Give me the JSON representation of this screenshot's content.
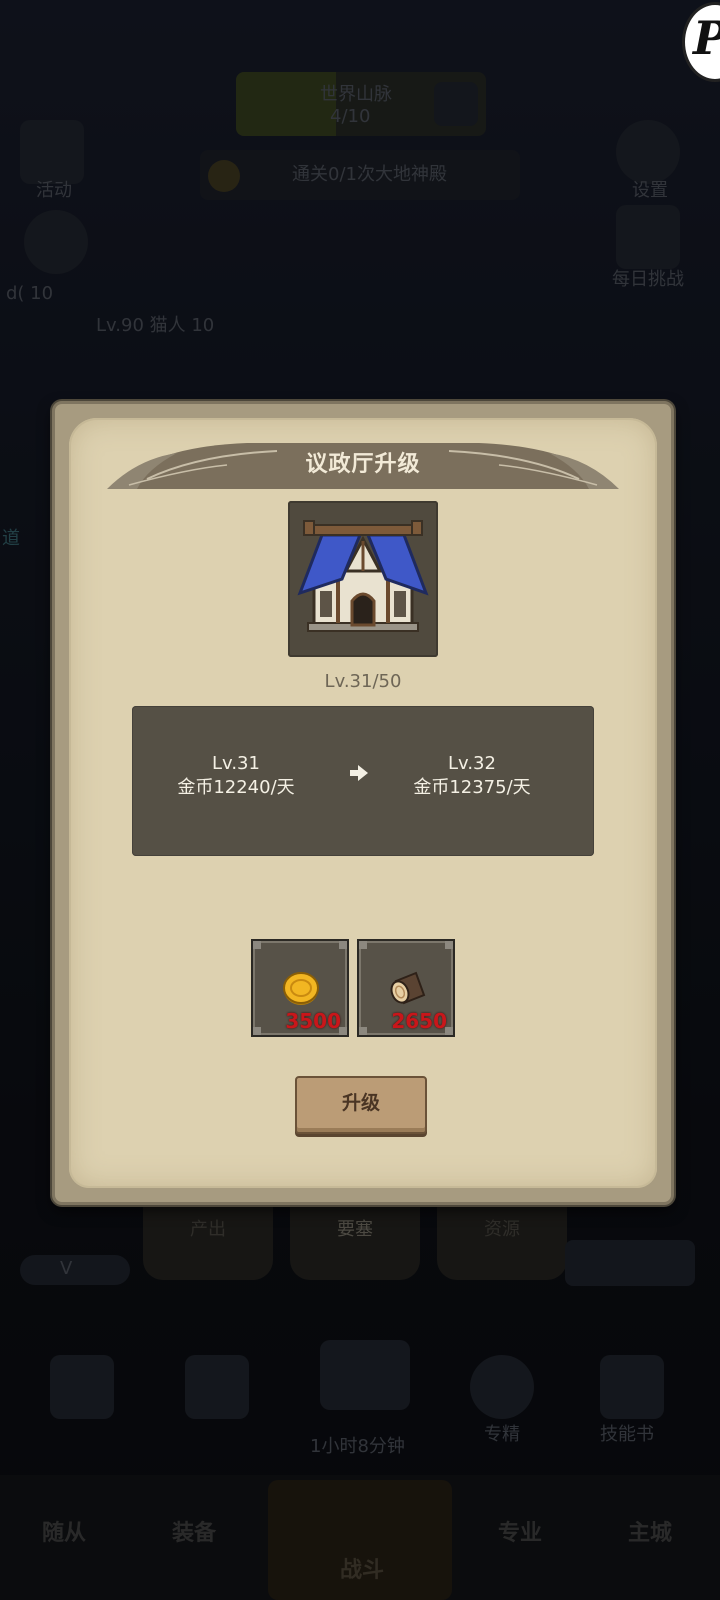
{
  "background": {
    "quest_title": "世界山脉",
    "quest_progress": "4/10",
    "task_text": "通关0/1次大地神殿",
    "left_top_label": "活动",
    "right_top_label": "设置",
    "right_second_label": "每日挑战",
    "level_line_1": "d(   10",
    "level_line_2": "Lv.90 猫人   10",
    "side_badge": "道",
    "tabs": {
      "output": "产出",
      "fortress": "要塞",
      "resources": "资源"
    },
    "vip_label": "V",
    "timer_text": "1小时8分钟",
    "shortcut_labels": [
      "专精",
      "技能书"
    ],
    "nav": {
      "followers": "随从",
      "equipment": "装备",
      "battle": "战斗",
      "profession": "专业",
      "main_city": "主城"
    }
  },
  "logo": {
    "letter": "P"
  },
  "dialog": {
    "title": "议政厅升级",
    "level": "Lv.31/50",
    "current": {
      "level": "Lv.31",
      "income": "金币12240/天"
    },
    "next": {
      "level": "Lv.32",
      "income": "金币12375/天"
    },
    "costs": [
      {
        "icon": "gold-coin-icon",
        "amount": "3500"
      },
      {
        "icon": "wood-log-icon",
        "amount": "2650"
      }
    ],
    "upgrade_label": "升级"
  },
  "colors": {
    "parchment": "#ddd1b0",
    "panel": "#555045",
    "cost_red": "#c9161a",
    "button": "#bb9c76"
  }
}
